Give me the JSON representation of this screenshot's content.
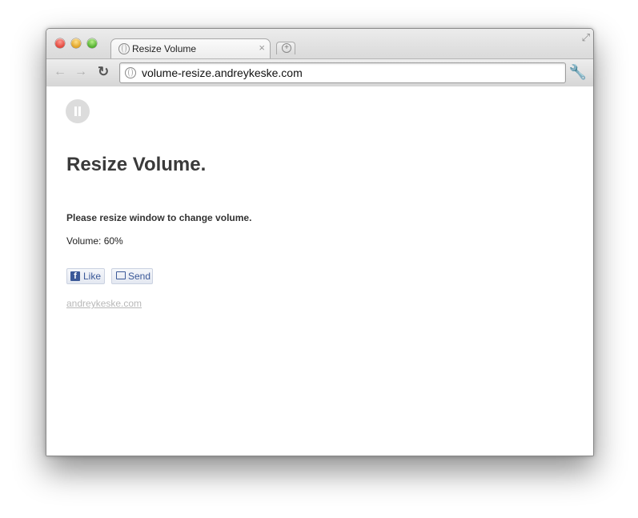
{
  "browser": {
    "tab_title": "Resize Volume",
    "tab_close": "×",
    "url": "volume-resize.andreykeske.com",
    "icons": {
      "back": "back-arrow-icon",
      "forward": "forward-arrow-icon",
      "reload": "reload-icon",
      "menu": "wrench-icon",
      "fullscreen": "fullscreen-icon",
      "new_tab": "new-tab-icon"
    }
  },
  "page": {
    "heading": "Resize Volume.",
    "instruction": "Please resize window to change volume.",
    "volume_label": "Volume: 60%",
    "volume_value": 0.6,
    "like_label": "Like",
    "send_label": "Send",
    "site_link": "andreykeske.com"
  },
  "colors": {
    "heading": "#3a3a3a",
    "link": "#b8b8b8",
    "facebook": "#3b5998"
  }
}
